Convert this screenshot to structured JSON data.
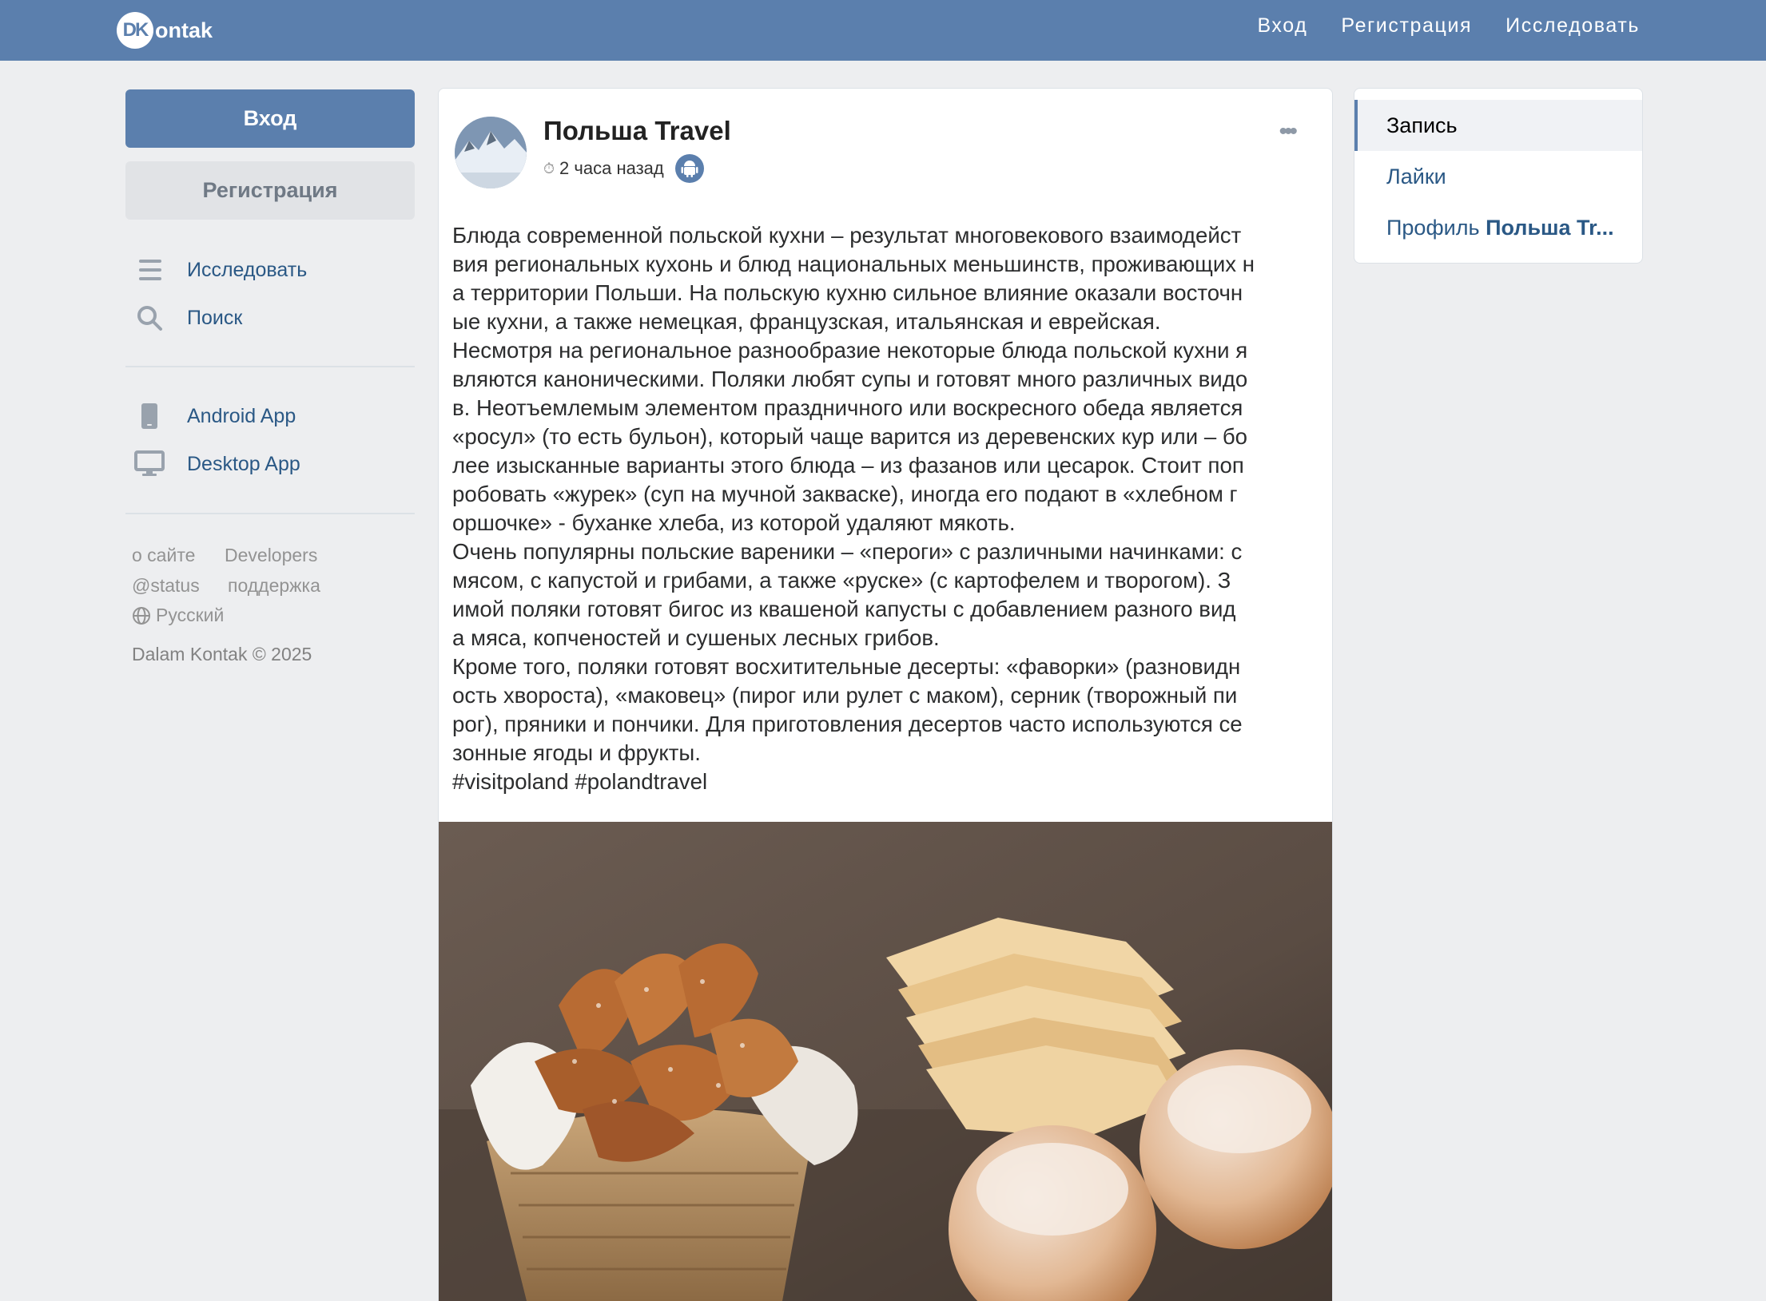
{
  "brand": {
    "logo_mark": "DK",
    "logo_text": "ontak"
  },
  "topnav": {
    "login": "Вход",
    "register": "Регистрация",
    "explore": "Исследовать"
  },
  "left": {
    "login_button": "Вход",
    "register_button": "Регистрация",
    "menu": [
      {
        "label": "Исследовать",
        "icon": "list-icon"
      },
      {
        "label": "Поиск",
        "icon": "search-icon"
      },
      {
        "label": "Android App",
        "icon": "phone-icon"
      },
      {
        "label": "Desktop App",
        "icon": "monitor-icon"
      }
    ],
    "footer_links": {
      "about": "о сайте",
      "developers": "Developers",
      "status": "@status",
      "support": "поддержка",
      "language": "Русский"
    },
    "copyright": "Dalam Kontak © 2025"
  },
  "post": {
    "author": "Польша Travel",
    "time": "2 часа назад",
    "platform_icon": "android-icon",
    "lines": [
      "Блюда современной польской кухни – результат многовекового взаимодейст",
      "вия региональных кухонь и блюд национальных меньшинств, проживающих н",
      "а территории Польши. На польскую кухню сильное влияние оказали восточн",
      "ые кухни, а также немецкая, французская, итальянская и еврейская.",
      "Несмотря на региональное разнообразие некоторые блюда польской кухни я",
      "вляются каноническими. Поляки любят супы и готовят много различных видо",
      "в. Неотъемлемым элементом праздничного или воскресного обеда является",
      "«росул» (то есть бульон), который чаще варится из деревенских кур или – бо",
      "лее изысканные варианты этого блюда – из фазанов или цесарок. Стоит поп",
      "робовать «журек» (суп на мучной закваске), иногда его подают в «хлебном г",
      "оршочке» - буханке хлеба, из которой удаляют мякоть.",
      "Очень популярны польские вареники – «пероги» с различными начинками: с",
      "мясом, с капустой и грибами, а также «руске» (с картофелем и творогом). З",
      "имой поляки готовят бигос из квашеной капусты с добавлением разного вид",
      "а мяса, копченостей и сушеных лесных грибов.",
      "Кроме того, поляки готовят восхитительные десерты: «фаворки» (разновидн",
      "ость хвороста), «маковец» (пирог или рулет с маком), серник (творожный пи",
      "рог), пряники и пончики. Для приготовления десертов часто используются се",
      "зонные ягоды и фрукты.",
      "#visitpoland #polandtravel"
    ]
  },
  "rightnav": {
    "post": "Запись",
    "likes": "Лайки",
    "profile_prefix": "Профиль ",
    "profile_name": "Польша Tr..."
  }
}
